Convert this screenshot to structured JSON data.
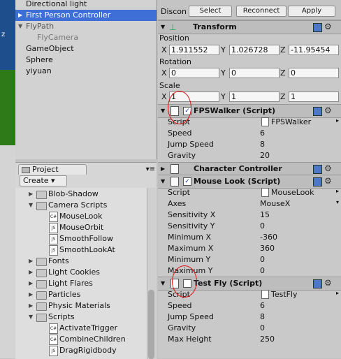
{
  "edge": {
    "z_label": "z"
  },
  "hierarchy": {
    "items": [
      {
        "label": "Directional light",
        "selected": false,
        "arrow": ""
      },
      {
        "label": "First Person Controller",
        "selected": true,
        "arrow": "▶"
      },
      {
        "label": "FlyPath",
        "selected": false,
        "arrow": "▼"
      },
      {
        "label": "FlyCamera",
        "selected": false,
        "arrow": ""
      },
      {
        "label": "GameObject",
        "selected": false,
        "arrow": ""
      },
      {
        "label": "Sphere",
        "selected": false,
        "arrow": ""
      },
      {
        "label": "yiyuan",
        "selected": false,
        "arrow": ""
      }
    ]
  },
  "project": {
    "tab_label": "Project",
    "create_label": "Create ▾",
    "tree": [
      {
        "label": "Blob-Shadow",
        "kind": "folder",
        "arrow": "▶"
      },
      {
        "label": "Camera Scripts",
        "kind": "folder",
        "arrow": "▼"
      },
      {
        "label": "MouseLook",
        "kind": "script",
        "badge": "C#"
      },
      {
        "label": "MouseOrbit",
        "kind": "script",
        "badge": "JS"
      },
      {
        "label": "SmoothFollow",
        "kind": "script",
        "badge": "JS"
      },
      {
        "label": "SmoothLookAt",
        "kind": "script",
        "badge": "JS"
      },
      {
        "label": "Fonts",
        "kind": "folder",
        "arrow": "▶"
      },
      {
        "label": "Light Cookies",
        "kind": "folder",
        "arrow": "▶"
      },
      {
        "label": "Light Flares",
        "kind": "folder",
        "arrow": "▶"
      },
      {
        "label": "Particles",
        "kind": "folder",
        "arrow": "▶"
      },
      {
        "label": "Physic Materials",
        "kind": "folder",
        "arrow": "▶"
      },
      {
        "label": "Scripts",
        "kind": "folder",
        "arrow": "▼"
      },
      {
        "label": "ActivateTrigger",
        "kind": "script",
        "badge": "C#"
      },
      {
        "label": "CombineChildren",
        "kind": "script",
        "badge": "C#"
      },
      {
        "label": "DragRigidbody",
        "kind": "script",
        "badge": "JS"
      }
    ]
  },
  "inspector": {
    "disconnect_label": "Discon",
    "select_label": "Select",
    "reconnect_label": "Reconnect",
    "apply_label": "Apply",
    "transform": {
      "title": "Transform",
      "position_label": "Position",
      "rotation_label": "Rotation",
      "scale_label": "Scale",
      "axis_x": "X",
      "axis_y": "Y",
      "axis_z": "Z",
      "position": {
        "x": "1.911552",
        "y": "1.026728",
        "z": "-11.95454"
      },
      "rotation": {
        "x": "0",
        "y": "0",
        "z": "0"
      },
      "scale": {
        "x": "1",
        "y": "1",
        "z": "1"
      }
    },
    "fpswalker": {
      "title": "FPSWalker (Script)",
      "enabled": true,
      "props": [
        {
          "label": "Script",
          "value": "FPSWalker"
        },
        {
          "label": "Speed",
          "value": "6"
        },
        {
          "label": "Jump Speed",
          "value": "8"
        },
        {
          "label": "Gravity",
          "value": "20"
        }
      ]
    },
    "character_controller": {
      "title": "Character Controller"
    },
    "mouselook": {
      "title": "Mouse Look (Script)",
      "enabled": true,
      "props": [
        {
          "label": "Script",
          "value": "MouseLook"
        },
        {
          "label": "Axes",
          "value": "MouseX"
        },
        {
          "label": "Sensitivity X",
          "value": "15"
        },
        {
          "label": "Sensitivity Y",
          "value": "0"
        },
        {
          "label": "Minimum X",
          "value": "-360"
        },
        {
          "label": "Maximum X",
          "value": "360"
        },
        {
          "label": "Minimum Y",
          "value": "0"
        },
        {
          "label": "Maximum Y",
          "value": "0"
        }
      ]
    },
    "testfly": {
      "title": "Test Fly (Script)",
      "enabled": false,
      "props": [
        {
          "label": "Script",
          "value": "TestFly"
        },
        {
          "label": "Speed",
          "value": "6"
        },
        {
          "label": "Jump Speed",
          "value": "8"
        },
        {
          "label": "Gravity",
          "value": "0"
        },
        {
          "label": "Max Height",
          "value": "250"
        }
      ]
    }
  }
}
